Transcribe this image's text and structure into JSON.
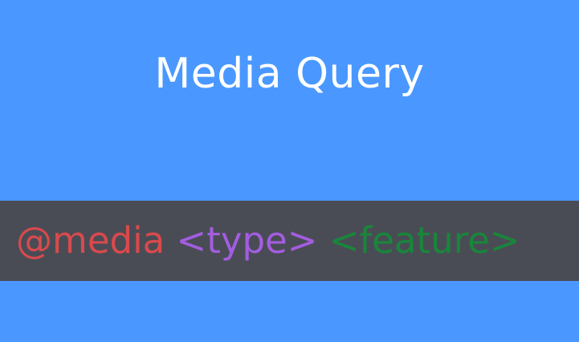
{
  "slide": {
    "title": "Media Query",
    "code": {
      "parts": [
        {
          "text": "@media",
          "color": "#d84a4d"
        },
        {
          "text": "<type>",
          "color": "#a25de0"
        },
        {
          "text": "<feature>",
          "color": "#18863b"
        }
      ]
    }
  },
  "colors": {
    "background": "#4a98ff",
    "code_band": "#4a4c55",
    "title_text": "#ffffff"
  }
}
